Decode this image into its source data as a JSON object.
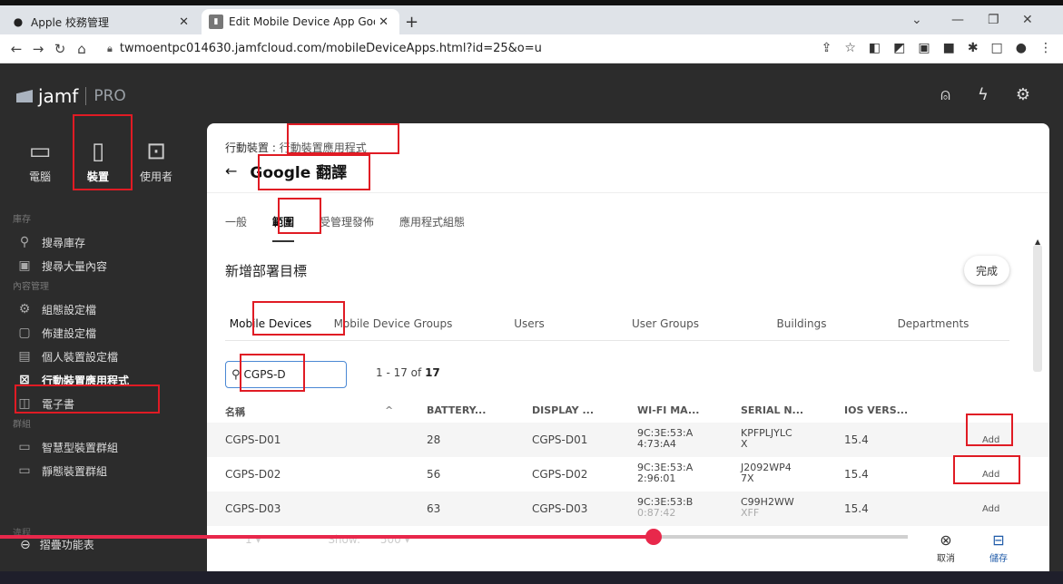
{
  "browser": {
    "tabs": [
      {
        "title": "Apple 校務管理",
        "icon": "apple-icon"
      },
      {
        "title": "Edit Mobile Device App Googl",
        "icon": "jamf-icon"
      }
    ],
    "url": "twmoentpc014630.jamfcloud.com/mobileDeviceApps.html?id=25&o=u"
  },
  "app": {
    "logo_text": "jamf",
    "logo_pro": "PRO"
  },
  "sidebar": {
    "categories": [
      {
        "label": "電腦",
        "icon": "laptop-icon"
      },
      {
        "label": "裝置",
        "icon": "phone-icon"
      },
      {
        "label": "使用者",
        "icon": "user-icon"
      }
    ],
    "sections": [
      {
        "title": "庫存",
        "items": [
          {
            "label": "搜尋庫存",
            "icon": "search-icon"
          },
          {
            "label": "搜尋大量內容",
            "icon": "box-icon"
          }
        ]
      },
      {
        "title": "內容管理",
        "items": [
          {
            "label": "組態設定檔",
            "icon": "gear-icon"
          },
          {
            "label": "佈建設定檔",
            "icon": "document-icon"
          },
          {
            "label": "個人裝置設定檔",
            "icon": "profile-icon"
          },
          {
            "label": "行動裝置應用程式",
            "icon": "app-icon"
          },
          {
            "label": "電子書",
            "icon": "book-icon"
          }
        ]
      },
      {
        "title": "群組",
        "items": [
          {
            "label": "智慧型裝置群組",
            "icon": "smart-group-icon"
          },
          {
            "label": "靜態裝置群組",
            "icon": "static-group-icon"
          }
        ]
      }
    ],
    "fold_label": "摺疊功能表",
    "partial_label": "違程"
  },
  "page": {
    "breadcrumb_root": "行動裝置 :",
    "breadcrumb_link": "行動裝置應用程式",
    "title": "Google 翻譯",
    "tabs": [
      "一般",
      "範圍",
      "受管理發佈",
      "應用程式組態"
    ],
    "section_title": "新增部署目標",
    "done_label": "完成",
    "subtabs": [
      "Mobile Devices",
      "Mobile Device Groups",
      "Users",
      "User Groups",
      "Buildings",
      "Departments"
    ],
    "search_value": "CGPS-D",
    "count_prefix": "1 - 17 of",
    "count_total": "17",
    "columns": [
      "名稱",
      "BATTERY...",
      "DISPLAY ...",
      "WI-FI MA...",
      "SERIAL N...",
      "IOS VERS..."
    ],
    "rows": [
      {
        "name": "CGPS-D01",
        "battery": "28",
        "display": "CGPS-D01",
        "wifi1": "9C:3E:53:A",
        "wifi2": "4:73:A4",
        "serial1": "KPFPLJYLC",
        "serial2": "X",
        "ios": "15.4",
        "action": "Add"
      },
      {
        "name": "CGPS-D02",
        "battery": "56",
        "display": "CGPS-D02",
        "wifi1": "9C:3E:53:A",
        "wifi2": "2:96:01",
        "serial1": "J2092WP4",
        "serial2": "7X",
        "ios": "15.4",
        "action": "Add"
      },
      {
        "name": "CGPS-D03",
        "battery": "63",
        "display": "CGPS-D03",
        "wifi1": "9C:3E:53:B",
        "wifi2": "0:87:42",
        "serial1": "C99H2WW",
        "serial2": "XFF",
        "ios": "15.4",
        "action": "Add"
      }
    ],
    "pager_show": "Show:",
    "pager_size": "500",
    "cancel_label": "取消",
    "save_label": "儲存"
  },
  "video": {
    "progress": 0.72
  },
  "colors": {
    "annotation": "#e01b24",
    "progress": "#e8284b",
    "accent": "#1e5aa8"
  }
}
